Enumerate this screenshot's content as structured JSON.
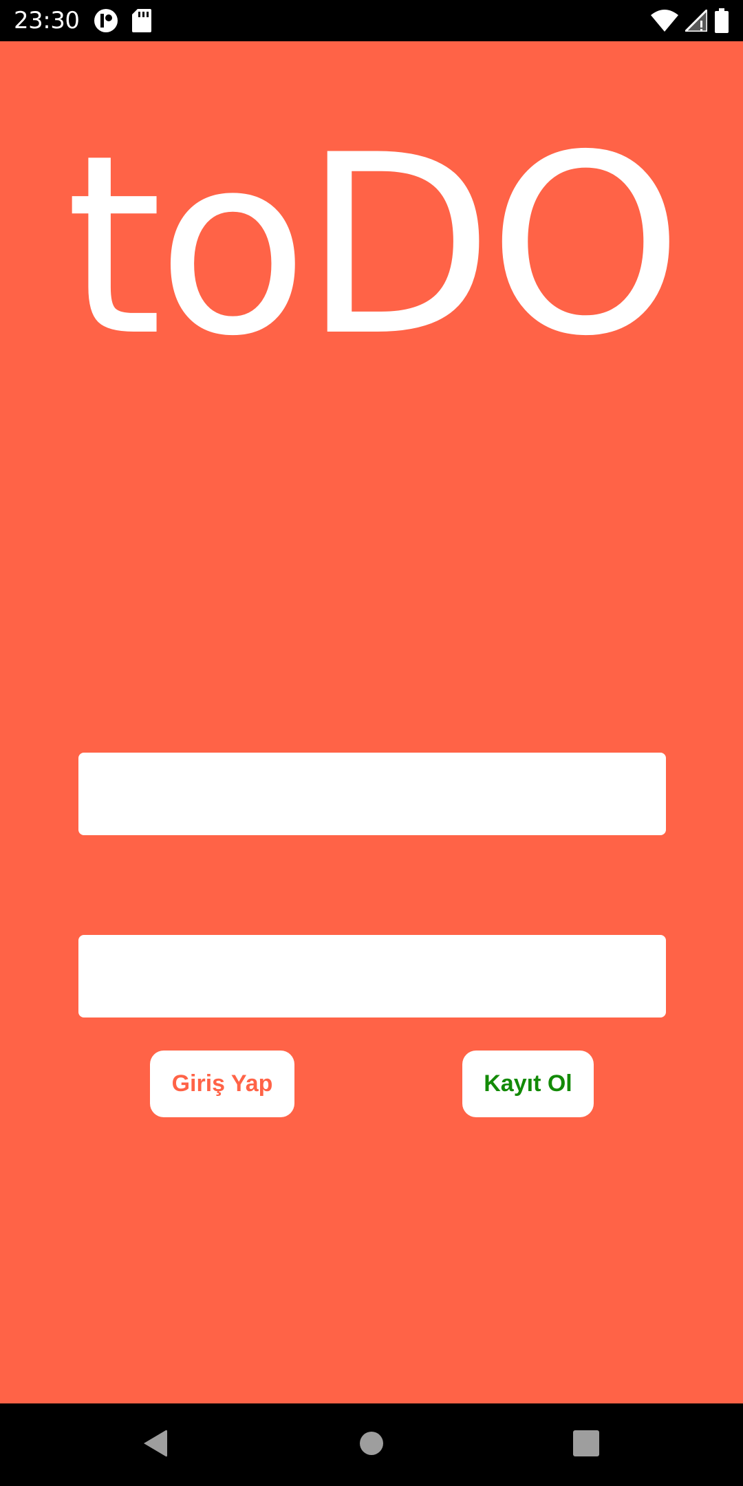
{
  "status_bar": {
    "time": "23:30",
    "left_icons": [
      "notification-app-icon",
      "sd-card-icon"
    ],
    "right_icons": [
      "wifi-icon",
      "cell-signal-icon",
      "battery-icon"
    ]
  },
  "app": {
    "logo_text": "toDO",
    "background_color": "#FF6347",
    "username_field": {
      "value": "",
      "placeholder": ""
    },
    "password_field": {
      "value": "",
      "placeholder": ""
    },
    "login_button": {
      "label": "Giriş Yap",
      "color": "#FF6347"
    },
    "register_button": {
      "label": "Kayıt Ol",
      "color": "#138A07"
    }
  },
  "nav_bar": {
    "buttons": [
      "back-icon",
      "home-icon",
      "recents-icon"
    ]
  }
}
